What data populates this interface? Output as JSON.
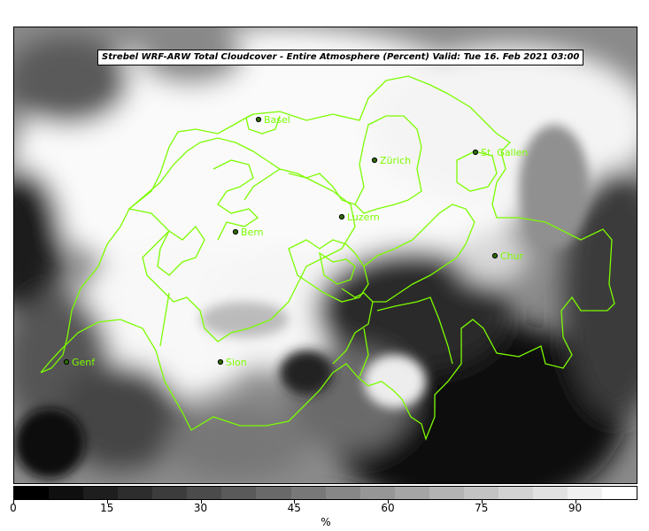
{
  "title": "Strebel WRF-ARW Total Cloudcover - Entire Atmosphere (Percent)   Valid: Tue 16. Feb 2021 03:00",
  "colors": {
    "border": "#7cfc00",
    "city_marker_fill": "#2e6b00",
    "city_marker_stroke": "#000000"
  },
  "cities": [
    {
      "name": "Basel",
      "id": "basel"
    },
    {
      "name": "Zürich",
      "id": "zurich"
    },
    {
      "name": "St. Gallen",
      "id": "stgallen"
    },
    {
      "name": "Luzern",
      "id": "luzern"
    },
    {
      "name": "Bern",
      "id": "bern"
    },
    {
      "name": "Chur",
      "id": "chur"
    },
    {
      "name": "Genf",
      "id": "genf"
    },
    {
      "name": "Sion",
      "id": "sion"
    }
  ],
  "colorbar": {
    "unit": "%",
    "ticks": [
      "0",
      "15",
      "30",
      "45",
      "60",
      "75",
      "90"
    ],
    "segment_colors": [
      "#000000",
      "#0f0f0f",
      "#1e1e1e",
      "#2d2d2d",
      "#3c3c3c",
      "#4b4b4b",
      "#5a5a5a",
      "#696969",
      "#787878",
      "#878787",
      "#969696",
      "#a5a5a5",
      "#b4b4b4",
      "#c3c3c3",
      "#d2d2d2",
      "#e1e1e1",
      "#f0f0f0",
      "#ffffff"
    ]
  }
}
